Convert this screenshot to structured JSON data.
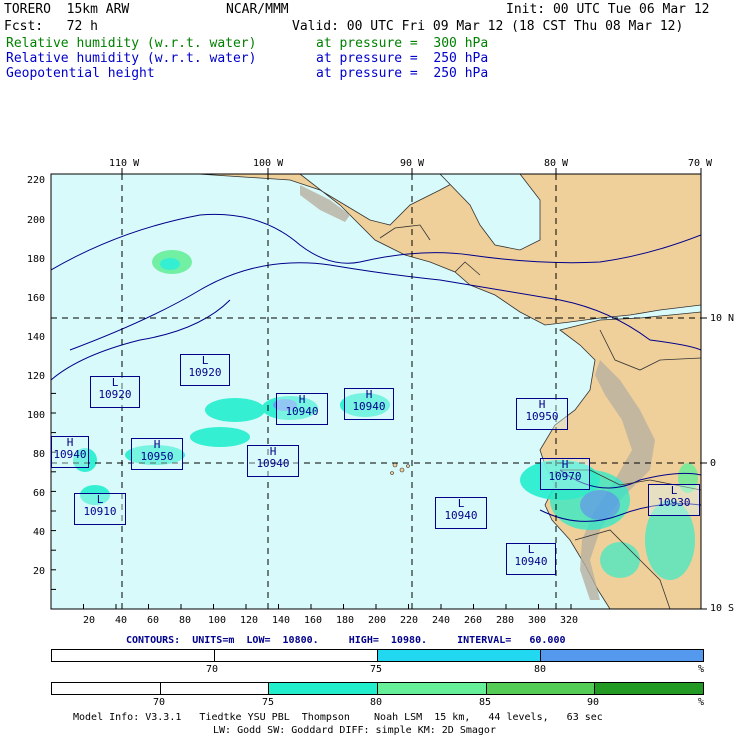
{
  "header": {
    "model": "TORERO  15km ARW",
    "center": "NCAR/MMM",
    "init": "Init: 00 UTC Tue 06 Mar 12",
    "fcst": "Fcst:   72 h",
    "valid": "Valid: 00 UTC Fri 09 Mar 12 (18 CST Thu 08 Mar 12)",
    "fields": [
      {
        "name": "Relative humidity (w.r.t. water)",
        "level": "at pressure =  300 hPa",
        "color": "#008000"
      },
      {
        "name": "Relative humidity (w.r.t. water)",
        "level": "at pressure =  250 hPa",
        "color": "#0000cc"
      },
      {
        "name": "Geopotential height",
        "level": "at pressure =  250 hPa",
        "color": "#0000cc"
      }
    ]
  },
  "map": {
    "lon_labels": [
      "110 W",
      "100 W",
      "90 W",
      "80 W",
      "70 W"
    ],
    "lat_labels": [
      "10 N",
      "0",
      "10 S"
    ],
    "y_ticks": [
      "220",
      "200",
      "180",
      "160",
      "140",
      "120",
      "100",
      "80",
      "60",
      "40",
      "20"
    ],
    "x_ticks": [
      "20",
      "40",
      "60",
      "80",
      "100",
      "120",
      "140",
      "160",
      "180",
      "200",
      "220",
      "240",
      "260",
      "280",
      "300",
      "320"
    ],
    "ocean_color": "#d8fafa",
    "land_color": "#efcf9a",
    "pressure_systems": [
      {
        "type": "L",
        "value": "10920"
      },
      {
        "type": "L",
        "value": "10920"
      },
      {
        "type": "H",
        "value": "10940"
      },
      {
        "type": "H",
        "value": "10940"
      },
      {
        "type": "H",
        "value": "10950"
      },
      {
        "type": "H",
        "value": "10940"
      },
      {
        "type": "H",
        "value": "10950"
      },
      {
        "type": "H",
        "value": "10940"
      },
      {
        "type": "L",
        "value": "10910"
      },
      {
        "type": "L",
        "value": "10940"
      },
      {
        "type": "H",
        "value": "10970"
      },
      {
        "type": "L",
        "value": "10930"
      },
      {
        "type": "L",
        "value": "10940"
      }
    ]
  },
  "contours": {
    "label": "CONTOURS:  UNITS=m  LOW=  10800.     HIGH=  10980.     INTERVAL=   60.000"
  },
  "colorbar1": {
    "labels": [
      "70",
      "75",
      "80",
      "%"
    ],
    "colors": [
      "#ffffff",
      "#ffffff",
      "#22d8f0",
      "#5599ee"
    ]
  },
  "colorbar2": {
    "labels": [
      "70",
      "75",
      "80",
      "85",
      "90",
      "%"
    ],
    "colors": [
      "#ffffff",
      "#ffffff",
      "#22eecc",
      "#66ee99",
      "#55cc55",
      "#229922"
    ]
  },
  "footer": {
    "line1": "Model Info: V3.3.1   Tiedtke YSU PBL  Thompson    Noah LSM  15 km,   44 levels,   63 sec",
    "line2": "LW: Godd SW: Goddard DIFF: simple KM: 2D Smagor"
  }
}
